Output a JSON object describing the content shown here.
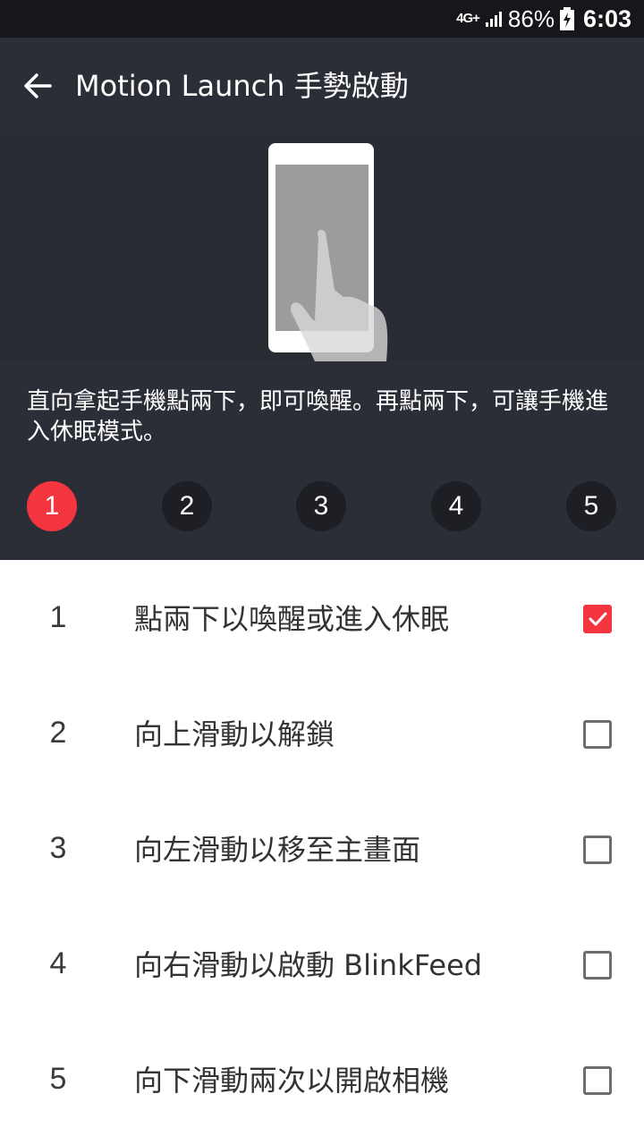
{
  "status_bar": {
    "network": "4G+",
    "battery": "86%",
    "time": "6:03"
  },
  "header": {
    "title": "Motion Launch 手勢啟動"
  },
  "description": "直向拿起手機點兩下，即可喚醒。再點兩下，可讓手機進入休眠模式。",
  "steps": [
    {
      "label": "1",
      "active": true
    },
    {
      "label": "2",
      "active": false
    },
    {
      "label": "3",
      "active": false
    },
    {
      "label": "4",
      "active": false
    },
    {
      "label": "5",
      "active": false
    }
  ],
  "gestures": [
    {
      "num": "1",
      "label": "點兩下以喚醒或進入休眠",
      "checked": true
    },
    {
      "num": "2",
      "label": "向上滑動以解鎖",
      "checked": false
    },
    {
      "num": "3",
      "label": "向左滑動以移至主畫面",
      "checked": false
    },
    {
      "num": "4",
      "label": "向右滑動以啟動 BlinkFeed",
      "checked": false
    },
    {
      "num": "5",
      "label": "向下滑動兩次以開啟相機",
      "checked": false
    }
  ],
  "colors": {
    "accent": "#f2353e",
    "appbar": "#2b2e36",
    "statusbar": "#15171a"
  },
  "icons": {
    "back": "arrow-left-icon",
    "check": "checkmark-icon"
  }
}
